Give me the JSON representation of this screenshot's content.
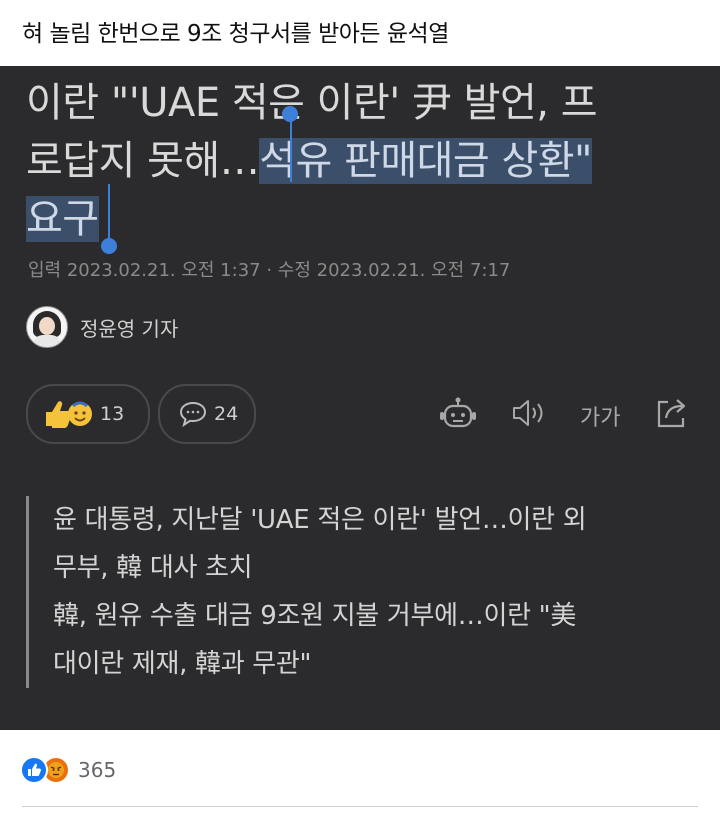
{
  "post": {
    "title": "혀 놀림 한번으로 9조 청구서를 받아든 윤석열"
  },
  "article": {
    "headline": {
      "line1": "이란 \"'UAE 적은 이란' 尹 발언, 프",
      "line2_plain": "로답지 못해…",
      "line2_selected": "석유 판매대금 상환\"",
      "line3_selected": "요구"
    },
    "meta": "입력 2023.02.21. 오전 1:37 · 수정 2023.02.21. 오전 7:17",
    "author": "정윤영 기자",
    "reaction_count": "13",
    "comment_count": "24",
    "font_size_label": "가가",
    "summary": [
      "윤 대통령, 지난달 'UAE 적은 이란' 발언…이란 외",
      "무부, 韓 대사 초치",
      "韓, 원유 수출 대금 9조원 지불 거부에…이란 \"美",
      "대이란 제재, 韓과 무관\""
    ]
  },
  "footer": {
    "reaction_count": "365"
  },
  "colors": {
    "article_bg": "#2b2b2d",
    "selection": "#3b4f6a",
    "cursor": "#3d7fd9",
    "like": "#1877f2",
    "angry": "#e9710f"
  },
  "icons": [
    "like-emoji-icon",
    "comment-bubble-icon",
    "robot-icon",
    "speaker-icon",
    "font-size-icon",
    "share-icon",
    "like-reaction-icon",
    "angry-reaction-icon"
  ]
}
